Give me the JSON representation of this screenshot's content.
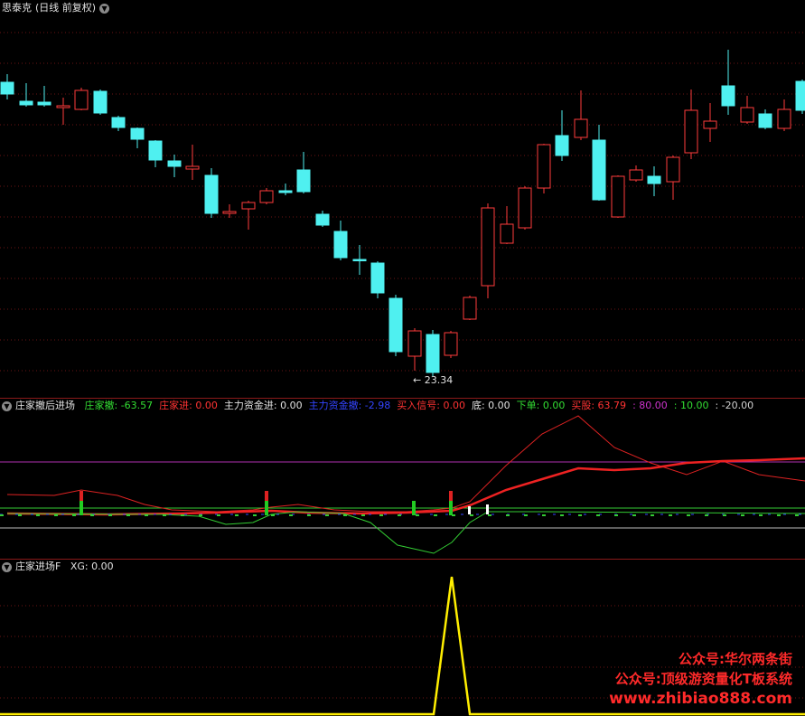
{
  "panel1": {
    "title": "思泰克",
    "period": "(日线 前复权)",
    "low_marker": "23.34"
  },
  "panel2": {
    "name": "庄家撤后进场",
    "items": [
      {
        "label": "庄家撤:",
        "value": "-63.57",
        "color": "#33dd33"
      },
      {
        "label": "庄家进:",
        "value": "0.00",
        "color": "#ff3333"
      },
      {
        "label": "主力资金进:",
        "value": "0.00",
        "color": "#e0e0e0"
      },
      {
        "label": "主力资金撤:",
        "value": "-2.98",
        "color": "#3344ff"
      },
      {
        "label": "买入信号:",
        "value": "0.00",
        "color": "#ff3333"
      },
      {
        "label": "底:",
        "value": "0.00",
        "color": "#e0e0e0"
      },
      {
        "label": "下单:",
        "value": "0.00",
        "color": "#33dd33"
      },
      {
        "label": "买股:",
        "value": "63.79",
        "color": "#ff3333"
      },
      {
        "label": ":",
        "value": "80.00",
        "color": "#cc33cc"
      },
      {
        "label": ":",
        "value": "10.00",
        "color": "#33dd33"
      },
      {
        "label": ":",
        "value": "-20.00",
        "color": "#d0d0d0"
      }
    ]
  },
  "panel3": {
    "name": "庄家进场F",
    "items": [
      {
        "label": "XG:",
        "value": "0.00",
        "color": "#e0e0e0"
      }
    ]
  },
  "watermark": {
    "line1": "公众号:华尔两条街",
    "line2": "公众号:顶级游资量化T板系统",
    "line3": "www.zhibiao888.com"
  },
  "colors": {
    "up": "#ff3b3b",
    "down": "#4ff0f0",
    "grid": "#7a1a1a",
    "separator": "#8b1a1a"
  }
}
